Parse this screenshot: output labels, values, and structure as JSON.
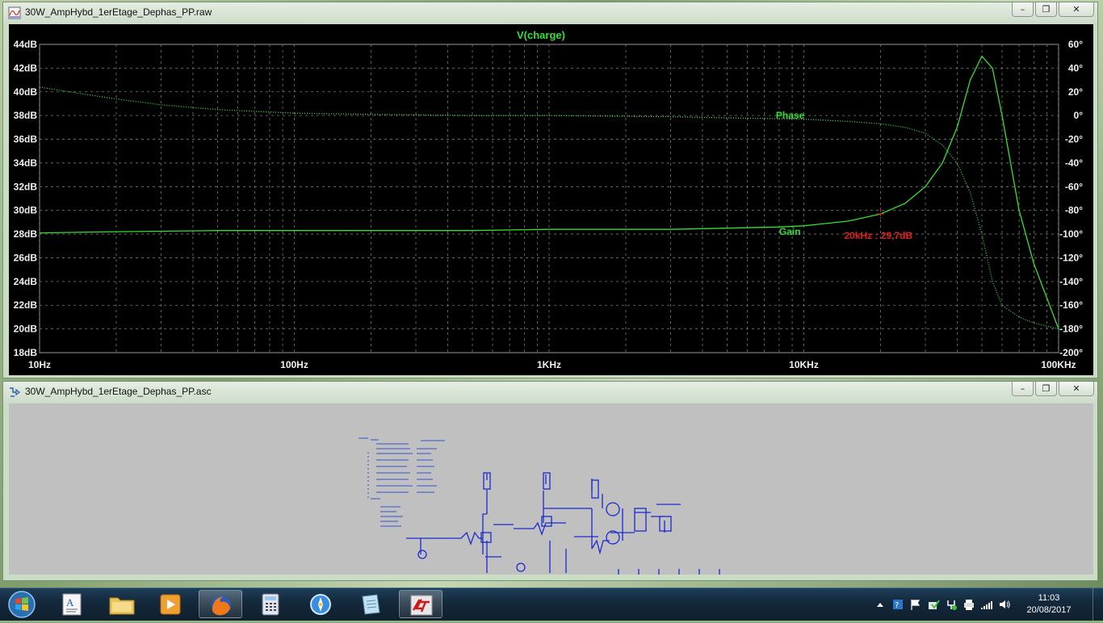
{
  "plot_window": {
    "title": "30W_AmpHybd_1erEtage_Dephas_PP.raw",
    "minimize": "–",
    "restore": "❐",
    "close": "✕"
  },
  "schematic_window": {
    "title": "30W_AmpHybd_1erEtage_Dephas_PP.asc",
    "minimize": "–",
    "restore": "❐",
    "close": "✕"
  },
  "chart_data": {
    "type": "line",
    "title": "V(charge)",
    "x_scale": "log",
    "xlim": [
      10,
      100000
    ],
    "x_tick_labels": [
      "10Hz",
      "100Hz",
      "1KHz",
      "10KHz",
      "100KHz"
    ],
    "x_tick_values": [
      10,
      100,
      1000,
      10000,
      100000
    ],
    "ylim_left": [
      18,
      44
    ],
    "y_left_tick_labels": [
      "44dB",
      "42dB",
      "40dB",
      "38dB",
      "36dB",
      "34dB",
      "32dB",
      "30dB",
      "28dB",
      "26dB",
      "24dB",
      "22dB",
      "20dB",
      "18dB"
    ],
    "ylim_right": [
      -200,
      60
    ],
    "y_right_tick_labels": [
      "60°",
      "40°",
      "20°",
      "0°",
      "-20°",
      "-40°",
      "-60°",
      "-80°",
      "-100°",
      "-120°",
      "-140°",
      "-160°",
      "-180°",
      "-200°"
    ],
    "grid": true,
    "background": "#000000",
    "curve_color": "#33e033",
    "cursor_color": "#e02020",
    "series": [
      {
        "name": "Gain",
        "axis": "left",
        "style": "solid",
        "x": [
          10,
          20,
          50,
          100,
          500,
          1000,
          3000,
          5000,
          8000,
          10000,
          15000,
          20000,
          25000,
          30000,
          35000,
          40000,
          45000,
          50000,
          55000,
          60000,
          70000,
          80000,
          100000
        ],
        "y": [
          28.1,
          28.2,
          28.3,
          28.3,
          28.3,
          28.4,
          28.4,
          28.5,
          28.6,
          28.7,
          29.1,
          29.7,
          30.6,
          32.0,
          34.0,
          37.0,
          41.0,
          43.0,
          42.0,
          38.0,
          30.0,
          25.5,
          20.0
        ]
      },
      {
        "name": "Phase",
        "axis": "right",
        "style": "dotted",
        "x": [
          10,
          15,
          20,
          30,
          50,
          100,
          200,
          500,
          1000,
          3000,
          5000,
          10000,
          15000,
          20000,
          25000,
          30000,
          35000,
          40000,
          45000,
          50000,
          55000,
          60000,
          70000,
          80000,
          100000
        ],
        "y": [
          24,
          18,
          14,
          9,
          5,
          2,
          1,
          0,
          0,
          -1,
          -2,
          -3,
          -5,
          -7,
          -10,
          -15,
          -25,
          -40,
          -65,
          -100,
          -140,
          -160,
          -170,
          -175,
          -180
        ]
      }
    ],
    "annotations": [
      {
        "text": "Phase",
        "x": 8000,
        "axis": "right",
        "y": 0
      },
      {
        "text": "Gain",
        "x": 8000,
        "axis": "left",
        "y": 28.2
      },
      {
        "text": "20kHz : 29,7dB",
        "x": 20000,
        "axis": "left",
        "y": 29.7,
        "color": "#e02020"
      }
    ]
  },
  "taskbar": {
    "items": [
      {
        "name": "text-editor-icon"
      },
      {
        "name": "file-explorer-icon"
      },
      {
        "name": "media-player-icon"
      },
      {
        "name": "firefox-icon"
      },
      {
        "name": "calculator-icon"
      },
      {
        "name": "compass-icon"
      },
      {
        "name": "notes-icon"
      },
      {
        "name": "ltspice-icon"
      }
    ],
    "time": "11:03",
    "date": "20/08/2017"
  }
}
